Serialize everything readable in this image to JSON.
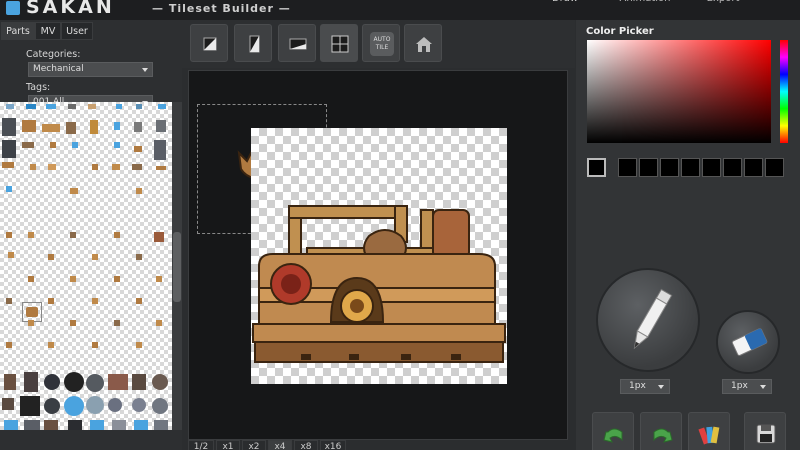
{
  "app": {
    "logo": "SAKAN",
    "subtitle": "— Tileset Builder —"
  },
  "top_tabs": [
    {
      "label": "Draw"
    },
    {
      "label": "Animation"
    },
    {
      "label": "Export"
    }
  ],
  "left_panel": {
    "tabs": [
      {
        "label": "Parts"
      },
      {
        "label": "MV"
      },
      {
        "label": "User"
      }
    ],
    "categories_label": "Categories:",
    "categories_value": "Mechanical",
    "tags_label": "Tags:",
    "tags_value": "001 All"
  },
  "toolbar": {
    "autotile_line1": "AUTO",
    "autotile_line2": "TILE"
  },
  "zoom": [
    {
      "label": "1/2"
    },
    {
      "label": "x1"
    },
    {
      "label": "x2"
    },
    {
      "label": "x4"
    },
    {
      "label": "x8"
    },
    {
      "label": "x16"
    }
  ],
  "right_panel": {
    "color_picker_title": "Color Picker",
    "current_color": "#000000",
    "pen_size": "1px",
    "eraser_size": "1px"
  },
  "colors": {
    "accent": "#4aa3df",
    "panel": "#2d2f31",
    "canvas": "#161718"
  }
}
